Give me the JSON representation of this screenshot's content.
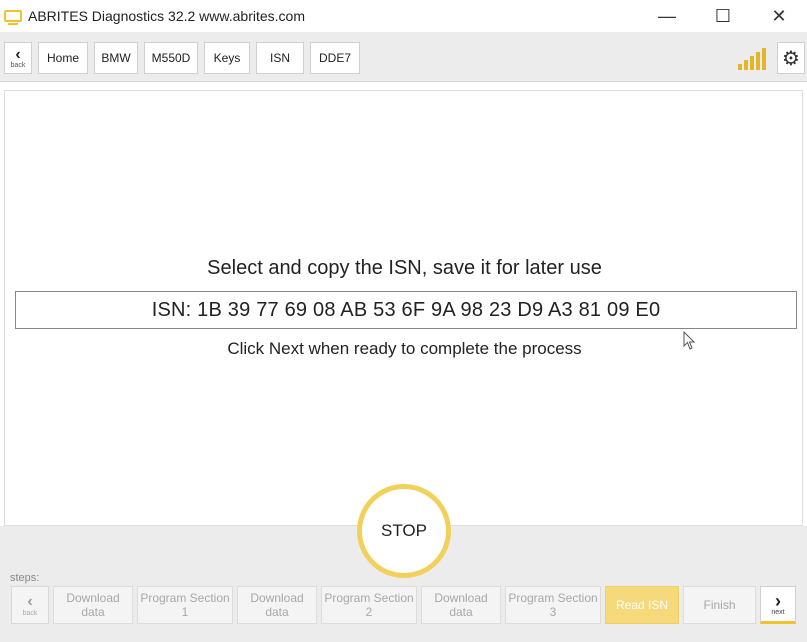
{
  "window": {
    "title": "ABRITES Diagnostics 32.2   www.abrites.com",
    "minimize_glyph": "—",
    "maximize_glyph": "☐",
    "close_glyph": "✕"
  },
  "nav": {
    "back_label": "back",
    "crumbs": [
      "Home",
      "BMW",
      "M550D",
      "Keys",
      "ISN",
      "DDE7"
    ]
  },
  "main": {
    "instruction": "Select and copy the ISN, save it for later use",
    "isn_value": "ISN: 1B 39 77 69 08 AB 53 6F 9A 98 23 D9 A3 81 09 E0",
    "hint": "Click Next when ready to complete the process"
  },
  "stop_label": "STOP",
  "steps": {
    "label": "steps:",
    "back_label": "back",
    "next_label": "next",
    "items": [
      {
        "line1": "Download",
        "line2": "data",
        "active": false
      },
      {
        "line1": "Program Section",
        "line2": "1",
        "active": false
      },
      {
        "line1": "Download",
        "line2": "data",
        "active": false
      },
      {
        "line1": "Program Section",
        "line2": "2",
        "active": false
      },
      {
        "line1": "Download",
        "line2": "data",
        "active": false
      },
      {
        "line1": "Program Section",
        "line2": "3",
        "active": false
      },
      {
        "line1": "Read ISN",
        "line2": "",
        "active": true
      },
      {
        "line1": "Finish",
        "line2": "",
        "active": false
      }
    ]
  },
  "colors": {
    "accent": "#f2c12e",
    "active_step": "#f5d97a",
    "toolbar_bg": "#ececec"
  }
}
